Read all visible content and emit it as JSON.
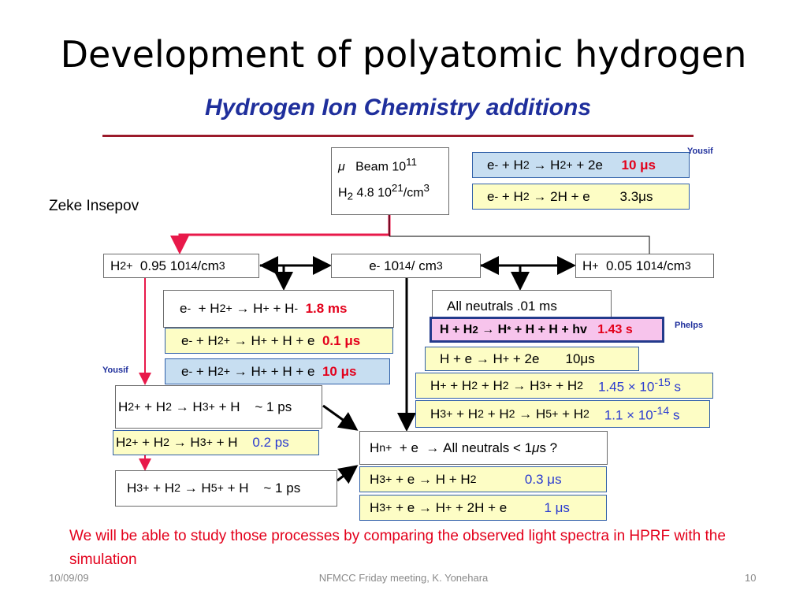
{
  "title": "Development of polyatomic hydrogen",
  "subtitle": "Hydrogen Ion Chemistry additions",
  "author": "Zeke Insepov",
  "tags": {
    "yousif_top": "Yousif",
    "yousif_left": "Yousif",
    "phelps": "Phelps"
  },
  "note": "We will be able to study those processes by comparing the observed light spectra in HPRF with the simulation",
  "footer": {
    "date": "10/09/09",
    "meeting": "NFMCC Friday meeting, K. Yonehara",
    "page": "10"
  },
  "colors": {
    "red_arrow": "#e8194a",
    "subtitle": "#1f2f9c",
    "highlight_text": "#e3001b",
    "yellow_box": "#fdfdc5",
    "blue_box": "#c7def1",
    "pink_box": "#f7c4ec"
  },
  "nodes": {
    "beam": {
      "line1": "Beam 10",
      "exp1": "11",
      "line2_mid": "4.8 10",
      "exp2": "21",
      "line2_end": "/cm"
    },
    "h2plus": {
      "density": "0.95 10",
      "exp": "14",
      "unit": "/cm"
    },
    "electrons": {
      "density": "10",
      "exp": "14",
      "unit": " / cm"
    },
    "hplus": {
      "density": "0.05 10",
      "exp": "14",
      "unit": "/cm"
    },
    "all_neutrals": "All neutrals .01 ms",
    "hn_recomb": "All neutrals  < 1 ",
    "hn_tail": "s ?"
  },
  "rates": {
    "ion_top_1": "10 ",
    "ion_top_2": "3.3 ",
    "rec_1": "1.8 ms",
    "rec_2": "0.1 ",
    "rec_3": "10 ",
    "phelps_1": "1.43 s",
    "phelps_2": "10 ",
    "three_body_1": "1.45 × 10",
    "three_body_1_exp": "-15",
    "three_body_2": "1.1 × 10",
    "three_body_2_exp": "-14",
    "h2_conv_1": "~ 1 ps",
    "h2_conv_2": "0.2 ps",
    "h3_conv": "~ 1 ps",
    "h3_rec_1": "0.3 ",
    "h3_rec_2": "1 "
  }
}
